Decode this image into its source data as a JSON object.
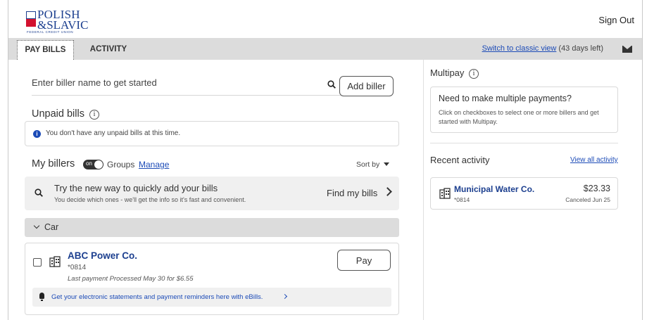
{
  "brand": {
    "line1": "POLISH",
    "line2": "&SLAVIC",
    "tagline": "FEDERAL CREDIT UNION"
  },
  "header": {
    "sign_out": "Sign Out"
  },
  "tabs": [
    {
      "label": "PAY BILLS",
      "active": true
    },
    {
      "label": "ACTIVITY",
      "active": false
    }
  ],
  "classic_view": {
    "link": "Switch to classic view",
    "days": "(43 days left)"
  },
  "search": {
    "placeholder": "Enter biller name to get started",
    "value": ""
  },
  "add_biller": "Add biller",
  "unpaid": {
    "title": "Unpaid bills",
    "message": "You don't have any unpaid bills at this time."
  },
  "my_billers": {
    "title": "My billers",
    "toggle_label": "on",
    "groups_label": "Groups",
    "manage_label": "Manage",
    "sort_label": "Sort by"
  },
  "promo": {
    "heading": "Try the new way to quickly add your bills",
    "subtext": "You decide which ones - we'll get the info so it's fast and convenient.",
    "action": "Find my bills"
  },
  "group": {
    "name": "Car",
    "expanded": true
  },
  "billers": [
    {
      "name": "ABC Power Co.",
      "account": "*0814",
      "last_payment": "Last payment Processed May 30 for $6.55",
      "pay_label": "Pay",
      "ebills_text": "Get your electronic statements and payment reminders here with eBills."
    }
  ],
  "multipay": {
    "title": "Multipay",
    "heading": "Need to make multiple payments?",
    "text": "Click on checkboxes to select one or more billers and get started with Multipay."
  },
  "recent_activity": {
    "title": "Recent activity",
    "view_all": "View all activity",
    "items": [
      {
        "name": "Municipal Water Co.",
        "account": "*0814",
        "amount": "$23.33",
        "status": "Canceled Jun 25"
      }
    ]
  },
  "colors": {
    "brand_blue": "#1c3f8f",
    "brand_red": "#d3122f",
    "link_blue": "#1c4bb7",
    "tab_bar": "#dcdcdc"
  }
}
